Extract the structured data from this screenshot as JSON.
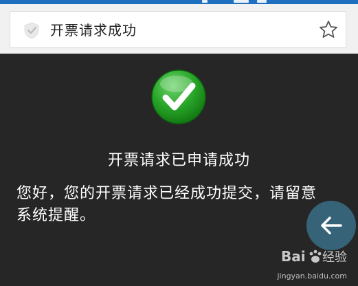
{
  "address_bar": {
    "title": "开票请求成功",
    "shield_icon": "shield-check-icon",
    "star_icon": "star-outline-icon"
  },
  "result": {
    "icon": "check-circle-icon",
    "icon_color": "#2aa82a",
    "heading": "开票请求已申请成功",
    "message": "您好，您的开票请求已经成功提交，请留意系统提醒。"
  },
  "controls": {
    "back_icon": "arrow-left-icon"
  },
  "watermark": {
    "logo_text": "Bai经验",
    "url": "jingyan.baidu.com"
  },
  "colors": {
    "background": "#262626",
    "header_background": "#f1f1f1",
    "status_bar": "#1f6fc0",
    "back_button": "#4696be"
  }
}
